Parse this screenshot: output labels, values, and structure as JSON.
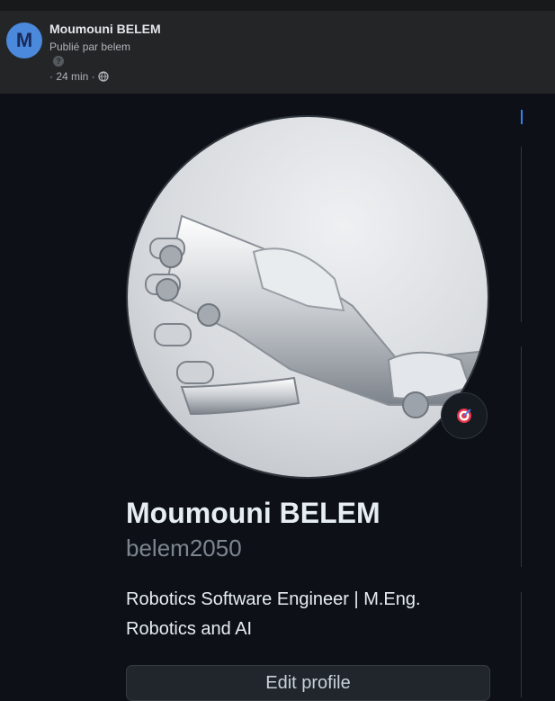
{
  "post": {
    "avatar_letter": "M",
    "author": "Moumouni BELEM",
    "byline": "Publié par belem",
    "help_glyph": "?",
    "time": "· 24 min ·"
  },
  "profile": {
    "name": "Moumouni BELEM",
    "login": "belem2050",
    "bio": "Robotics Software Engineer | M.Eng. Robotics and AI",
    "edit_label": "Edit profile"
  },
  "icons": {
    "globe": "globe-icon",
    "status": "target-icon"
  },
  "colors": {
    "avatar_bg": "#4a89dc",
    "page_bg": "#0d1117",
    "header_bg": "#242526",
    "accent": "#2f81f7"
  }
}
